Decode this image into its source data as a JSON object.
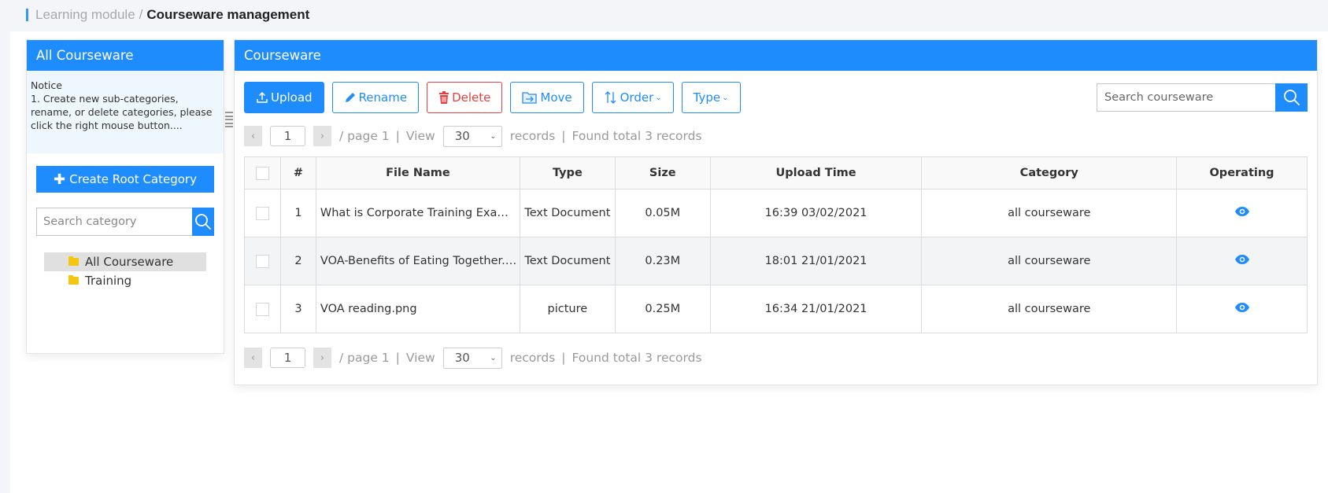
{
  "breadcrumb": {
    "parent": "Learning module",
    "separator": "/",
    "current": "Courseware management"
  },
  "sidebar": {
    "title": "All Courseware",
    "notice_title": "Notice",
    "notice_text": "1. Create new sub-categories, rename, or delete categories, please click the right mouse button....",
    "create_button": "Create Root Category",
    "search_placeholder": "Search category",
    "tree": [
      {
        "label": "All Courseware",
        "selected": true,
        "icon": "folder-icon"
      },
      {
        "label": "Training",
        "selected": false,
        "icon": "folder-icon"
      }
    ]
  },
  "main": {
    "title": "Courseware",
    "toolbar": {
      "upload": "Upload",
      "rename": "Rename",
      "delete": "Delete",
      "move": "Move",
      "order": "Order",
      "type": "Type"
    },
    "search_placeholder": "Search courseware",
    "pager": {
      "prev": "‹",
      "next": "›",
      "page_value": "1",
      "page_text": "/ page 1",
      "view_label": "View",
      "per_page": "30",
      "records_label": "records",
      "pipe": "|",
      "found_text": "Found total 3 records"
    },
    "table": {
      "columns": [
        "#",
        "File Name",
        "Type",
        "Size",
        "Upload Time",
        "Category",
        "Operating"
      ],
      "rows": [
        {
          "num": "1",
          "file_name": "What is Corporate Training Examin...",
          "type": "Text Document",
          "size": "0.05M",
          "upload_time": "16:39 03/02/2021",
          "category": "all courseware",
          "action_icon": "eye-icon"
        },
        {
          "num": "2",
          "file_name": "VOA-Benefits of Eating Together.pdf",
          "type": "Text Document",
          "size": "0.23M",
          "upload_time": "18:01 21/01/2021",
          "category": "all courseware",
          "action_icon": "eye-icon"
        },
        {
          "num": "3",
          "file_name": "VOA reading.png",
          "type": "picture",
          "size": "0.25M",
          "upload_time": "16:34 21/01/2021",
          "category": "all courseware",
          "action_icon": "eye-icon"
        }
      ]
    }
  },
  "colors": {
    "primary": "#1e8cfc",
    "danger": "#e84040",
    "folder": "#f3c612",
    "notice_bg": "#eef6fe"
  }
}
